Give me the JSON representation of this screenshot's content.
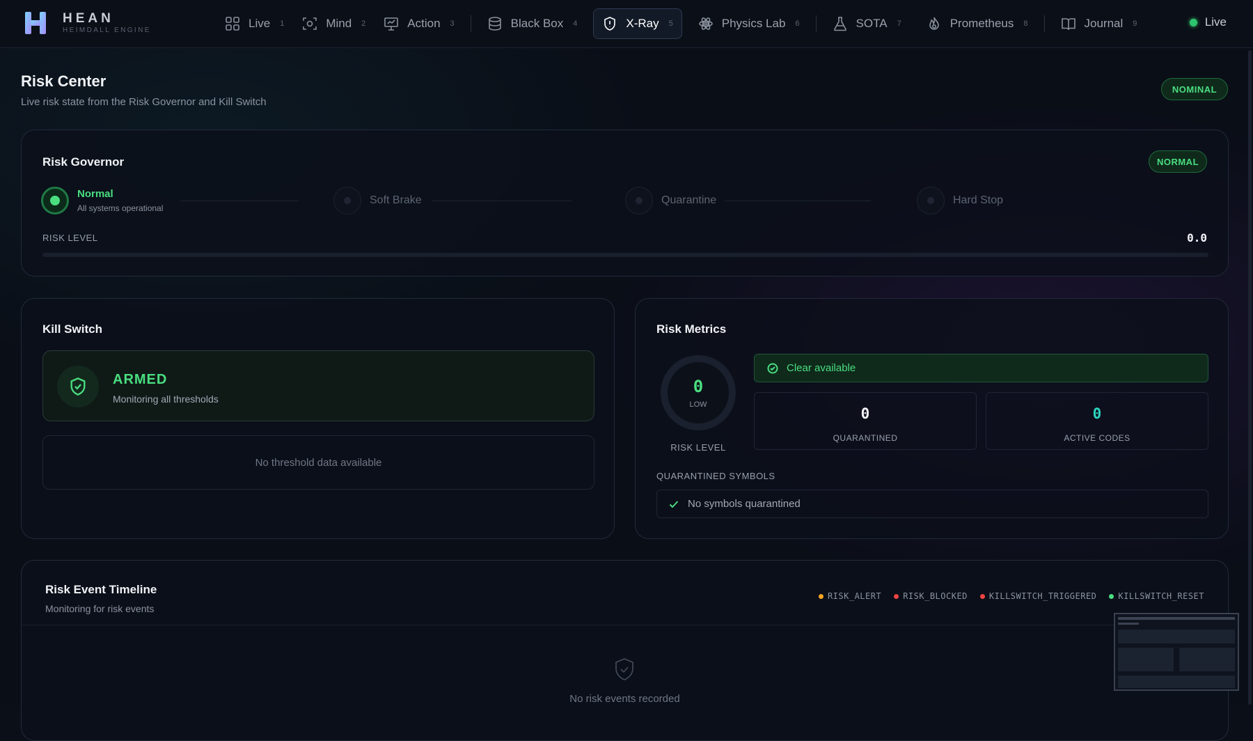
{
  "brand": {
    "name": "HEAN",
    "subtitle": "HEIMDALL ENGINE"
  },
  "nav": {
    "items": [
      {
        "label": "Live",
        "key": "1",
        "icon": "grid-icon"
      },
      {
        "label": "Mind",
        "key": "2",
        "icon": "scan-icon"
      },
      {
        "label": "Action",
        "key": "3",
        "icon": "presentation-icon"
      },
      {
        "label": "Black Box",
        "key": "4",
        "icon": "database-icon"
      },
      {
        "label": "X-Ray",
        "key": "5",
        "icon": "shield-alert-icon",
        "active": true
      },
      {
        "label": "Physics Lab",
        "key": "6",
        "icon": "atom-icon"
      },
      {
        "label": "SOTA",
        "key": "7",
        "icon": "flask-icon"
      },
      {
        "label": "Prometheus",
        "key": "8",
        "icon": "flame-icon"
      },
      {
        "label": "Journal",
        "key": "9",
        "icon": "book-icon"
      }
    ],
    "status": "Live"
  },
  "page": {
    "title": "Risk Center",
    "subtitle": "Live risk state from the Risk Governor and Kill Switch",
    "status": "NOMINAL"
  },
  "governor": {
    "title": "Risk Governor",
    "status": "NORMAL",
    "stages": [
      {
        "label": "Normal",
        "desc": "All systems operational",
        "active": true
      },
      {
        "label": "Soft Brake",
        "active": false
      },
      {
        "label": "Quarantine",
        "active": false
      },
      {
        "label": "Hard Stop",
        "active": false
      }
    ],
    "risk_level_label": "RISK LEVEL",
    "risk_level_value": "0.0",
    "risk_level_fraction": 0.0
  },
  "kill_switch": {
    "title": "Kill Switch",
    "state": "ARMED",
    "state_desc": "Monitoring all thresholds",
    "threshold_empty": "No threshold data available"
  },
  "metrics": {
    "title": "Risk Metrics",
    "gauge_value": "0",
    "gauge_level": "LOW",
    "gauge_caption": "RISK LEVEL",
    "clear_text": "Clear available",
    "quarantined_value": "0",
    "quarantined_label": "QUARANTINED",
    "active_codes_value": "0",
    "active_codes_label": "ACTIVE CODES",
    "symbols_label": "QUARANTINED SYMBOLS",
    "symbols_empty": "No symbols quarantined"
  },
  "timeline": {
    "title": "Risk Event Timeline",
    "subtitle": "Monitoring for risk events",
    "legend": [
      {
        "label": "RISK_ALERT",
        "color": "#f5a524"
      },
      {
        "label": "RISK_BLOCKED",
        "color": "#ef4444"
      },
      {
        "label": "KILLSWITCH_TRIGGERED",
        "color": "#ef4444"
      },
      {
        "label": "KILLSWITCH_RESET",
        "color": "#4ade80"
      }
    ],
    "empty_text": "No risk events recorded"
  },
  "colors": {
    "accent_green": "#4ade80",
    "warn": "#f5a524",
    "danger": "#ef4444",
    "active_codes": "#2dd4bf"
  }
}
